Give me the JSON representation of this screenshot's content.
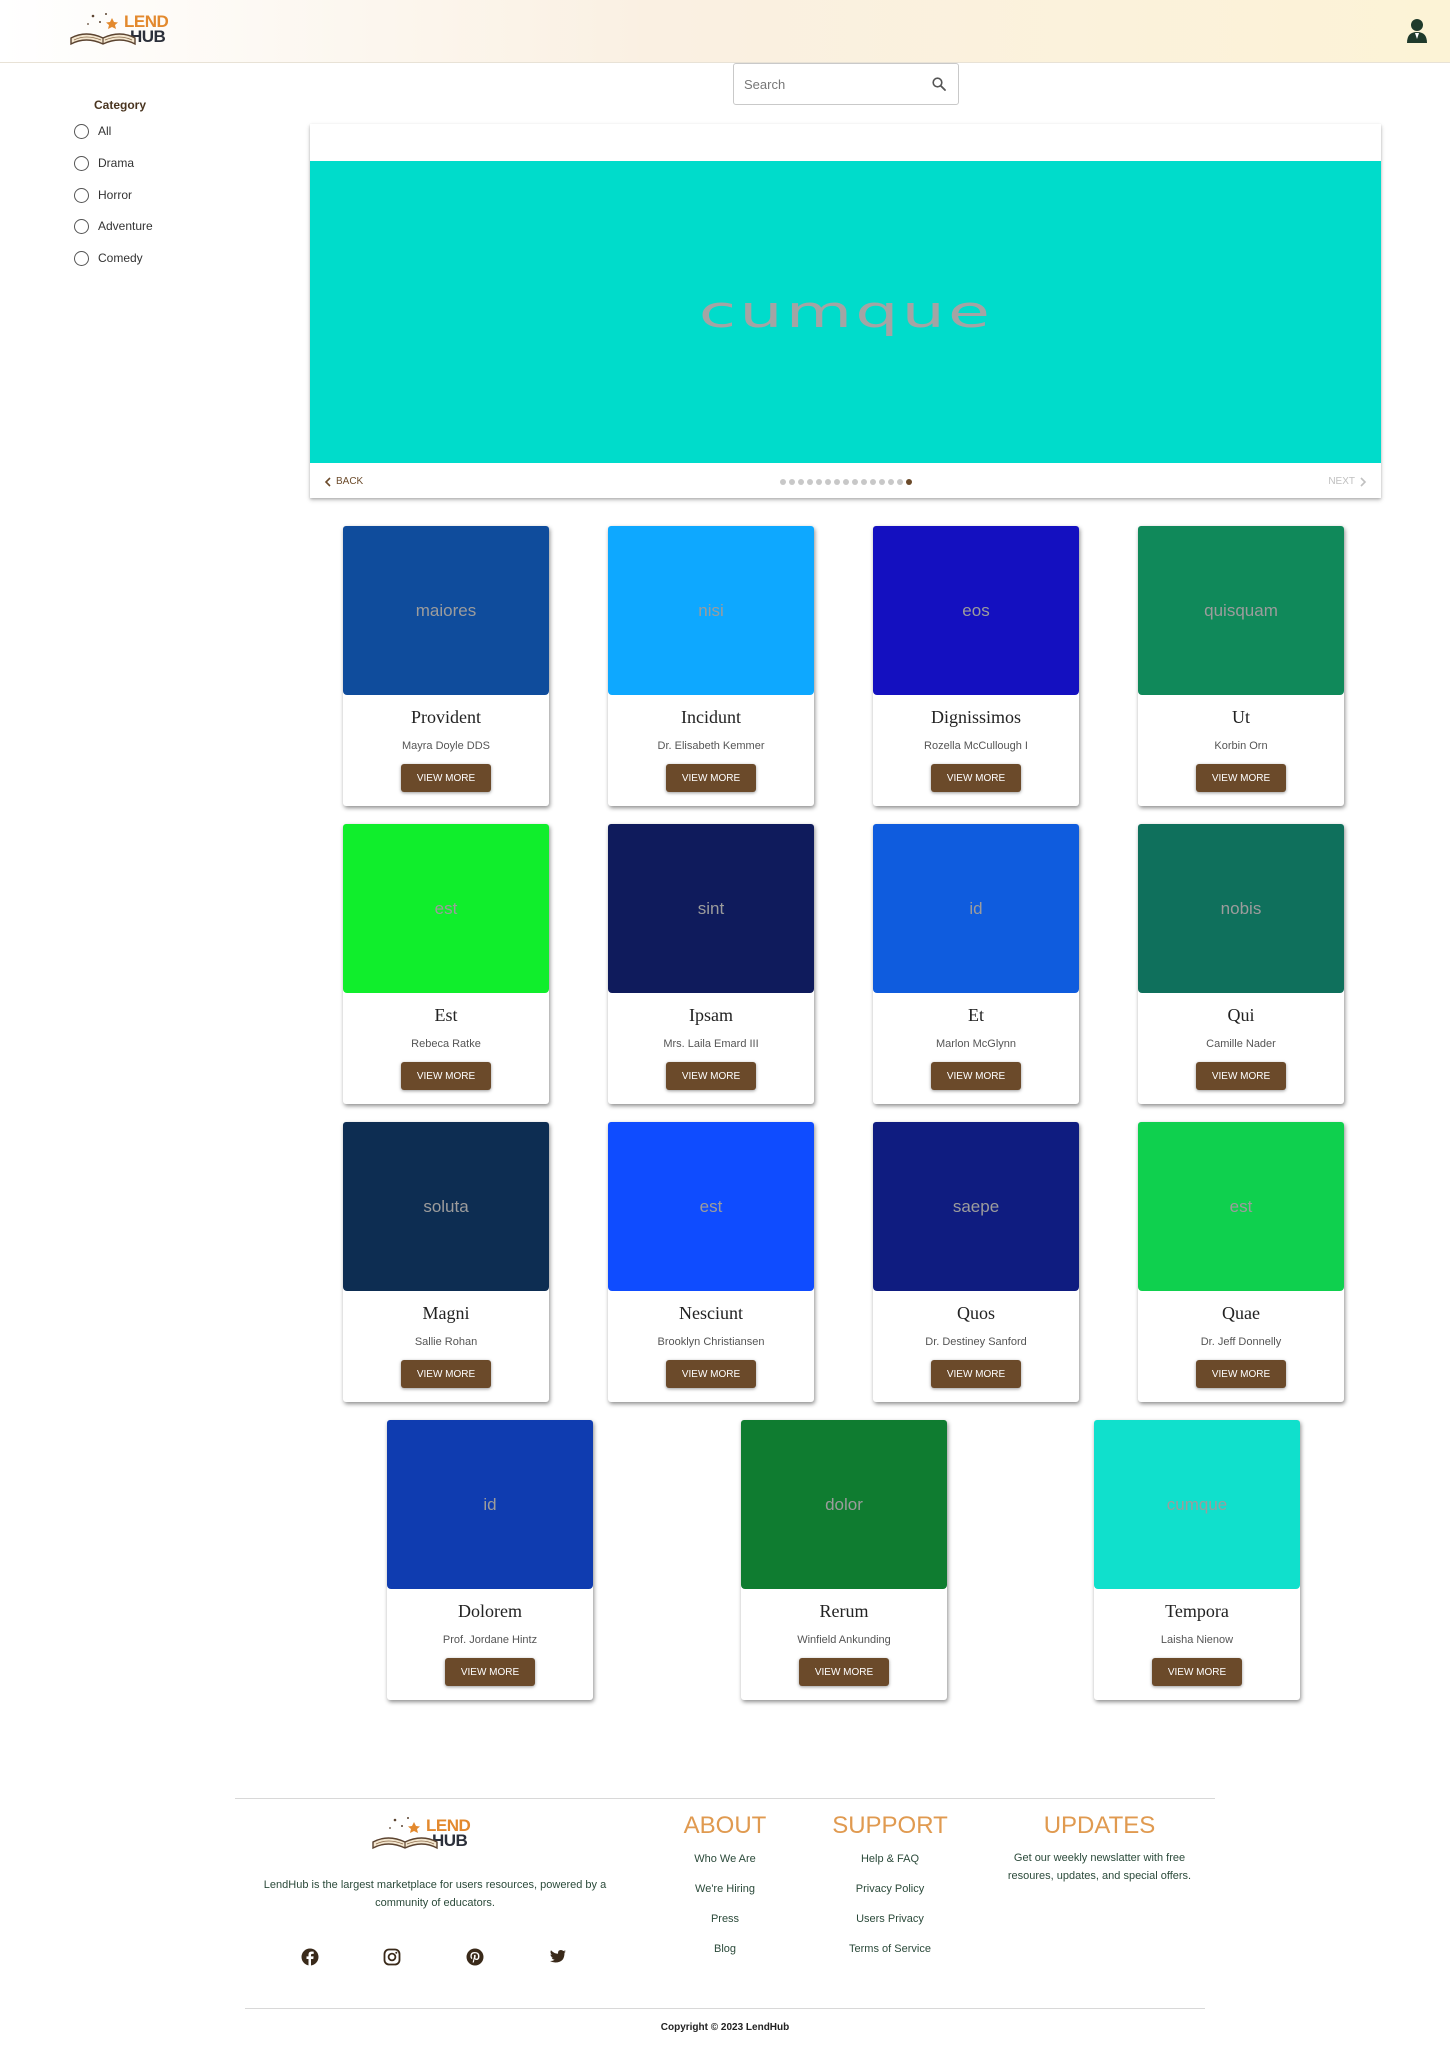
{
  "header": {
    "logo_line1": "LEND",
    "logo_line2": "HUB"
  },
  "search": {
    "placeholder": "Search",
    "value": ""
  },
  "sidebar": {
    "title": "Category",
    "options": [
      {
        "label": "All"
      },
      {
        "label": "Drama"
      },
      {
        "label": "Horror"
      },
      {
        "label": "Adventure"
      },
      {
        "label": "Comedy"
      }
    ]
  },
  "carousel": {
    "slide_text": "cumque",
    "slide_color": "#00dccb",
    "back_label": "BACK",
    "next_label": "NEXT",
    "total_slides": 15,
    "active_index": 14
  },
  "cards": [
    {
      "image_text": "maiores",
      "color": "#0f4c9c",
      "title": "Provident",
      "author": "Mayra Doyle DDS",
      "button": "VIEW MORE"
    },
    {
      "image_text": "nisi",
      "color": "#0ea8ff",
      "title": "Incidunt",
      "author": "Dr. Elisabeth Kemmer",
      "button": "VIEW MORE"
    },
    {
      "image_text": "eos",
      "color": "#1410c0",
      "title": "Dignissimos",
      "author": "Rozella McCullough I",
      "button": "VIEW MORE"
    },
    {
      "image_text": "quisquam",
      "color": "#10895a",
      "title": "Ut",
      "author": "Korbin Orn",
      "button": "VIEW MORE"
    },
    {
      "image_text": "est",
      "color": "#10ee2c",
      "title": "Est",
      "author": "Rebeca Ratke",
      "button": "VIEW MORE"
    },
    {
      "image_text": "sint",
      "color": "#0f1b5c",
      "title": "Ipsam",
      "author": "Mrs. Laila Emard III",
      "button": "VIEW MORE"
    },
    {
      "image_text": "id",
      "color": "#0f5cde",
      "title": "Et",
      "author": "Marlon McGlynn",
      "button": "VIEW MORE"
    },
    {
      "image_text": "nobis",
      "color": "#0f705c",
      "title": "Qui",
      "author": "Camille Nader",
      "button": "VIEW MORE"
    },
    {
      "image_text": "soluta",
      "color": "#0d2d52",
      "title": "Magni",
      "author": "Sallie Rohan",
      "button": "VIEW MORE"
    },
    {
      "image_text": "est",
      "color": "#0f4cff",
      "title": "Nesciunt",
      "author": "Brooklyn Christiansen",
      "button": "VIEW MORE"
    },
    {
      "image_text": "saepe",
      "color": "#0f1c80",
      "title": "Quos",
      "author": "Dr. Destiney Sanford",
      "button": "VIEW MORE"
    },
    {
      "image_text": "est",
      "color": "#0fd04e",
      "title": "Quae",
      "author": "Dr. Jeff Donnelly",
      "button": "VIEW MORE"
    },
    {
      "image_text": "id",
      "color": "#0f3cb0",
      "title": "Dolorem",
      "author": "Prof. Jordane Hintz",
      "button": "VIEW MORE"
    },
    {
      "image_text": "dolor",
      "color": "#0f7c30",
      "title": "Rerum",
      "author": "Winfield Ankunding",
      "button": "VIEW MORE"
    },
    {
      "image_text": "cumque",
      "color": "#10e0cc",
      "title": "Tempora",
      "author": "Laisha Nienow",
      "button": "VIEW MORE"
    }
  ],
  "footer": {
    "description": "LendHub is the largest marketplace for users resources, powered by a community of educators.",
    "about": {
      "heading": "ABOUT",
      "links": [
        "Who We Are",
        "We're Hiring",
        "Press",
        "Blog"
      ]
    },
    "support": {
      "heading": "SUPPORT",
      "links": [
        "Help & FAQ",
        "Privacy Policy",
        "Users Privacy",
        "Terms of Service"
      ]
    },
    "updates": {
      "heading": "UPDATES",
      "text": "Get our weekly newslatter with free resoures, updates, and special offers."
    },
    "social": [
      "facebook-icon",
      "instagram-icon",
      "pinterest-icon",
      "twitter-icon"
    ],
    "copyright": "Copyright © 2023 LendHub"
  }
}
